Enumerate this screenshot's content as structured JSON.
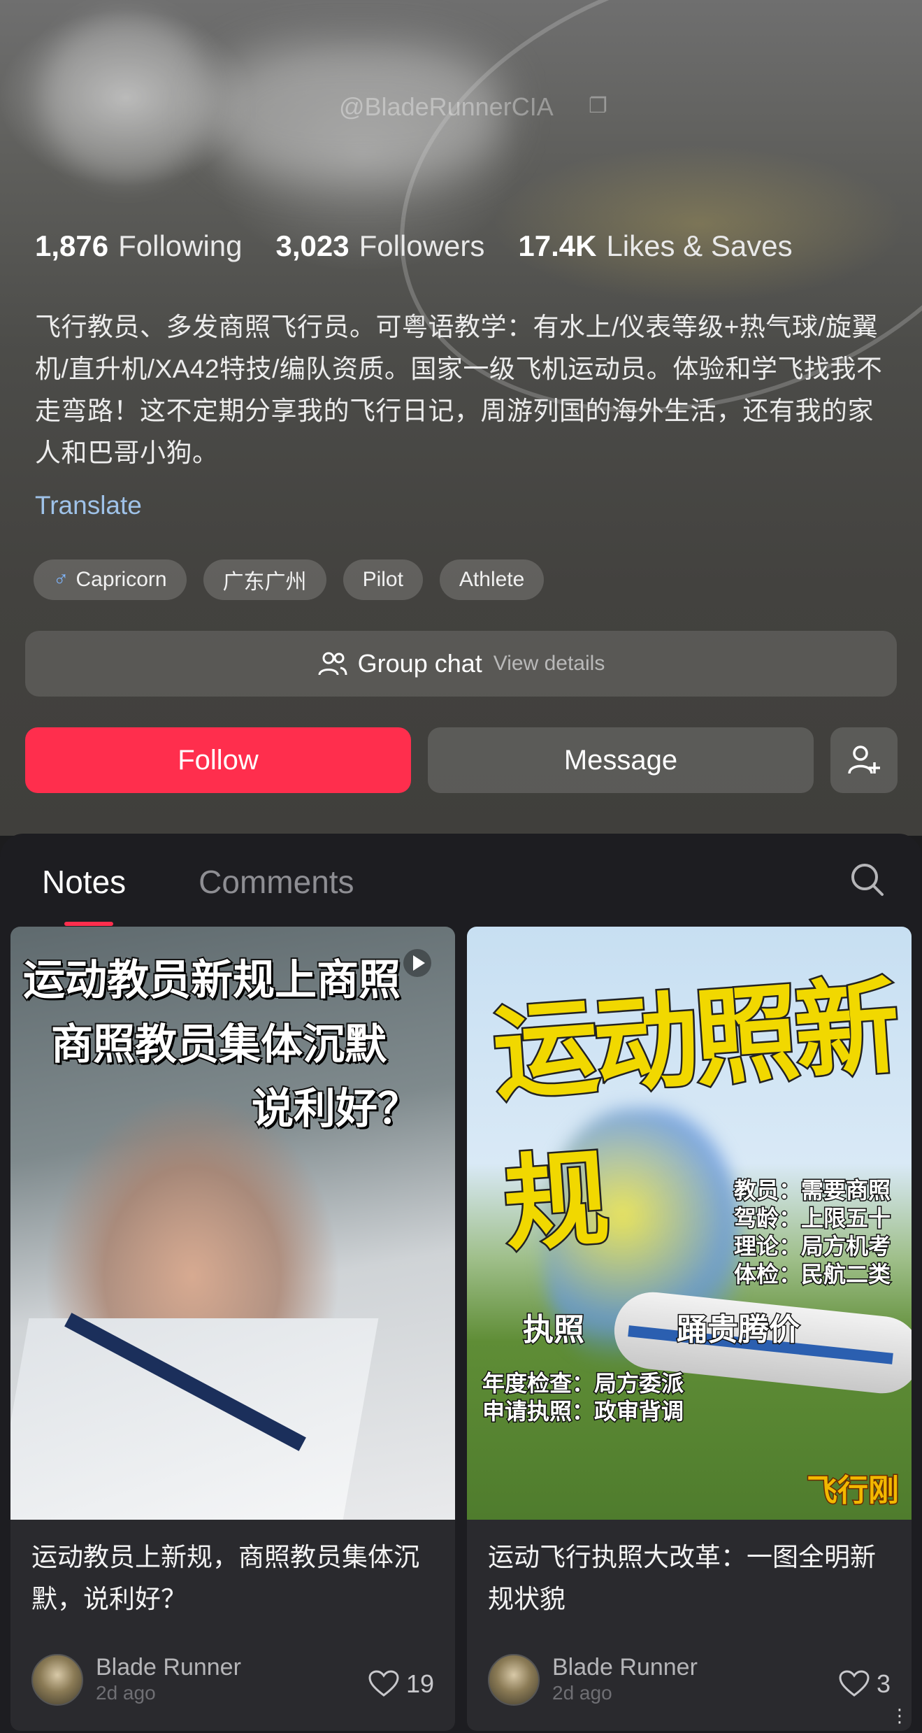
{
  "profile": {
    "handle": "@BladeRunnerCIA",
    "stats": {
      "following_value": "1,876",
      "following_label": "Following",
      "followers_value": "3,023",
      "followers_label": "Followers",
      "likes_value": "17.4K",
      "likes_label": "Likes & Saves"
    },
    "bio": "飞行教员、多发商照飞行员。可粤语教学：有水上/仪表等级+热气球/旋翼机/直升机/XA42特技/编队资质。国家一级飞机运动员。体验和学飞找我不走弯路！这不定期分享我的飞行日记，周游列国的海外生活，还有我的家人和巴哥小狗。",
    "translate_label": "Translate",
    "tags": [
      {
        "icon": "male-symbol",
        "label": "Capricorn"
      },
      {
        "label": "广东广州"
      },
      {
        "label": "Pilot"
      },
      {
        "label": "Athlete"
      }
    ],
    "group_chat": {
      "label": "Group chat",
      "sub_label": "View details"
    },
    "buttons": {
      "follow": "Follow",
      "message": "Message"
    }
  },
  "tabs": [
    {
      "label": "Notes",
      "active": true
    },
    {
      "label": "Comments",
      "active": false
    }
  ],
  "notes": [
    {
      "cover_lines": [
        "运动教员新规上商照",
        "商照教员集体沉默",
        "说利好？"
      ],
      "title": "运动教员上新规，商照教员集体沉默，说利好？",
      "author": "Blade Runner",
      "time": "2d ago",
      "likes": "19"
    },
    {
      "cover_big": "运动照新规",
      "cover_rules": [
        "教员：需要商照",
        "驾龄：上限五十",
        "理论：局方机考",
        "体检：民航二类"
      ],
      "cover_mid_left": "执照",
      "cover_mid_right": "踊贵腾价",
      "cover_bottom": [
        "年度检查：局方委派",
        "申请执照：政审背调"
      ],
      "cover_brand": "飞行刚",
      "title": "运动飞行执照大改革：一图全明新规状貌",
      "author": "Blade Runner",
      "time": "2d ago",
      "likes": "3"
    }
  ],
  "colors": {
    "accent": "#ff2e4d",
    "link": "#9fc2e8"
  }
}
